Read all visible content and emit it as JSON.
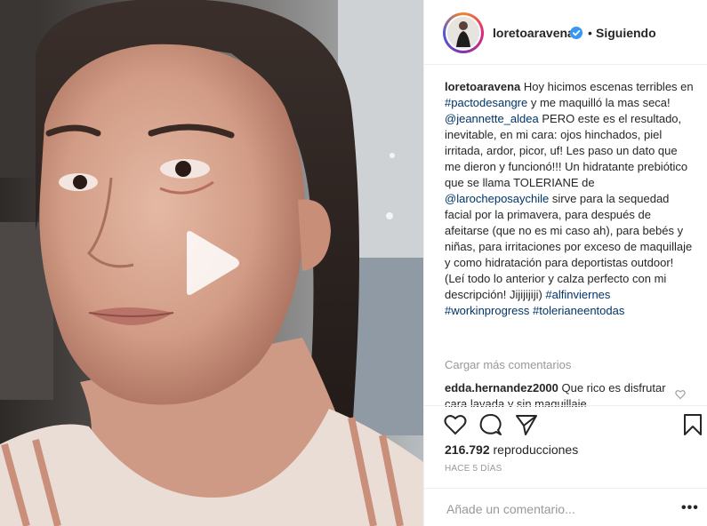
{
  "post": {
    "username": "loretoaravena",
    "follow_status": "Siguiendo",
    "separator": "•",
    "caption_segments": [
      {
        "text": "loretoaravena",
        "type": "user"
      },
      {
        "text": " Hoy hicimos escenas terribles en ",
        "type": "text"
      },
      {
        "text": "#pactodesangre",
        "type": "tag"
      },
      {
        "text": " y me maquilló la mas seca! ",
        "type": "text"
      },
      {
        "text": "@jeannette_aldea",
        "type": "tag"
      },
      {
        "text": " PERO este es el resultado, inevitable, en mi cara: ojos hinchados, piel irritada, ardor, picor, uf! Les paso un dato que me dieron y funcionó!!! Un hidratante prebiótico que se llama TOLERIANE de ",
        "type": "text"
      },
      {
        "text": "@larocheposaychile",
        "type": "tag"
      },
      {
        "text": " sirve para la sequedad facial por la primavera, para después de afeitarse (que no es mi caso ah), para bebés y niñas, para irritaciones por exceso de maquillaje y como hidratación para deportistas outdoor! (Leí todo lo anterior y calza perfecto con mi descripción! Jijijijiji) ",
        "type": "text"
      },
      {
        "text": "#alfinviernes",
        "type": "tag"
      },
      {
        "text": " ",
        "type": "text"
      },
      {
        "text": "#workinprogress",
        "type": "tag"
      },
      {
        "text": " ",
        "type": "text"
      },
      {
        "text": "#tolerianeentodas",
        "type": "tag"
      }
    ],
    "load_more": "Cargar más comentarios",
    "comment": {
      "user": "edda.hernandez2000",
      "text": " Que rico es disfrutar cara lavada y sin maquillaje"
    },
    "views_count": "216.792",
    "views_label": " reproducciones",
    "date": "HACE 5 DÍAS",
    "add_comment_placeholder": "Añade un comentario...",
    "more_options": "•••"
  },
  "icons": {
    "verified": "verified-badge-icon",
    "play": "play-icon",
    "like": "heart-icon",
    "comment": "comment-icon",
    "share": "share-icon",
    "save": "bookmark-icon"
  },
  "colors": {
    "link": "#003569",
    "verified": "#3897f0",
    "muted": "#999999",
    "text": "#262626"
  }
}
